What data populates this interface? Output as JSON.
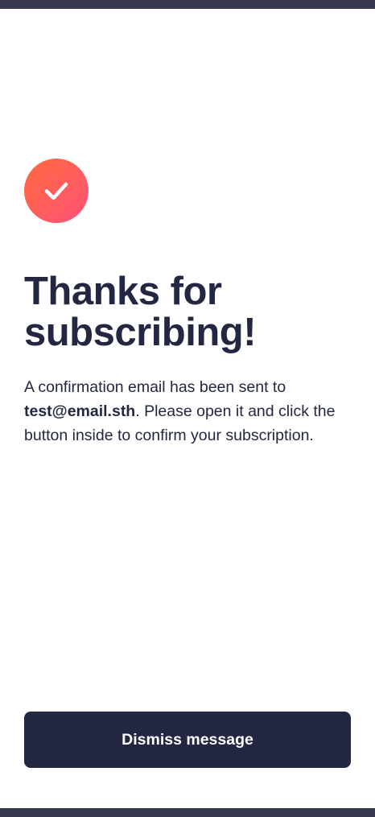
{
  "confirmation": {
    "title": "Thanks for subscribing!",
    "message_prefix": "A confirmation email has been sent to",
    "email": "test@email.sth",
    "message_suffix": ". Please open it and click the button inside to confirm your subscription.",
    "dismiss_label": "Dismiss message"
  },
  "icons": {
    "success": "checkmark-icon"
  },
  "colors": {
    "background": "#36384d",
    "card": "#ffffff",
    "text": "#242742",
    "accent_start": "#ff6a3a",
    "accent_end": "#ff527b",
    "button": "#242742",
    "button_text": "#ffffff"
  }
}
